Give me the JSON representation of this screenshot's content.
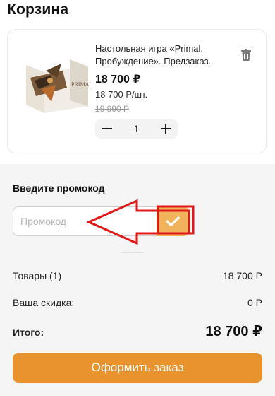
{
  "page": {
    "title": "Корзина"
  },
  "cart": {
    "items": [
      {
        "name": "Настольная игра «Primal. Пробуждение». Предзаказ.",
        "image_icon": "board-game-box-dragon",
        "price_total": "18 700 ₽",
        "price_unit": "18 700 Р/шт.",
        "price_old": "19 990 Р",
        "quantity": "1"
      }
    ]
  },
  "promo": {
    "title": "Введите промокод",
    "placeholder": "Промокод",
    "apply_icon": "checkmark-icon"
  },
  "summary": {
    "goods_label": "Товары (1)",
    "goods_value": "18 700 Р",
    "discount_label": "Ваша скидка:",
    "discount_value": "0 Р",
    "total_label": "Итого:",
    "total_value": "18 700 ₽",
    "checkout_label": "Оформить заказ"
  },
  "colors": {
    "accent": "#e8932e",
    "apply_button": "#f0b35c",
    "annotation": "#e01818",
    "summary_bg": "#f5f5f5"
  }
}
